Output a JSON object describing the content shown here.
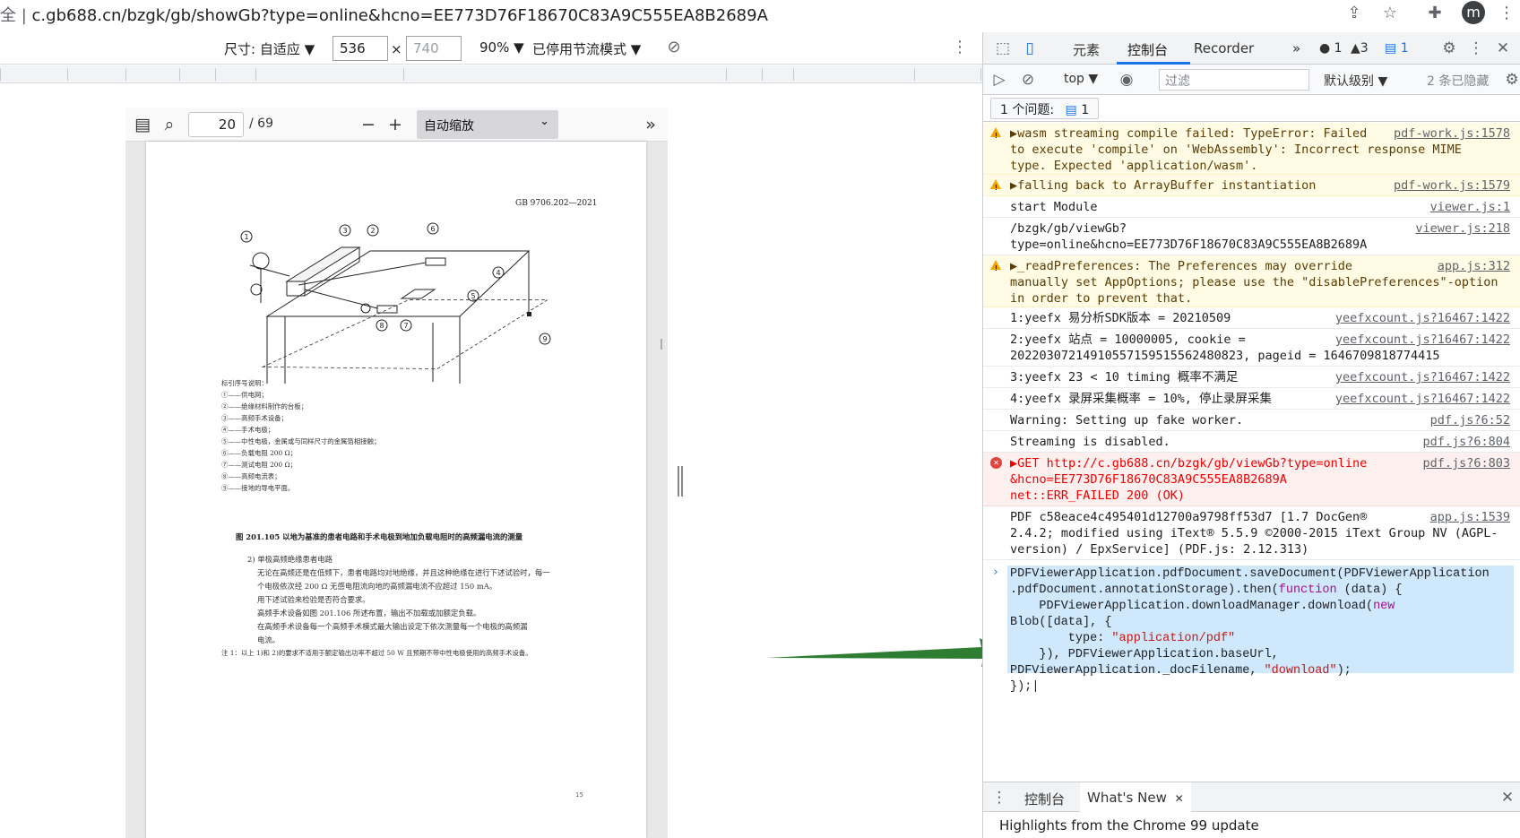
{
  "address_bar": {
    "prefix": "全 |",
    "url": "c.gb688.cn/bzgk/gb/showGb?type=online&hcno=EE773D76F18670C83A9C555EA8B2689A",
    "avatar_letter": "m"
  },
  "device_toolbar": {
    "dimensions_label": "尺寸: 自适应 ▼",
    "width_value": "536",
    "times": "×",
    "height_placeholder": "740",
    "zoom": "90% ▼",
    "throttle": "已停用节流模式 ▼"
  },
  "pdf_viewer": {
    "page_number": "20",
    "page_total": "/ 69",
    "zoom_option": "自动缩放",
    "page": {
      "standard_no": "GB 9706.202—2021",
      "legend_title": "标引序号说明：",
      "legend": [
        "①——供电网；",
        "②——绝缘材料制作的台板；",
        "③——高频手术设备；",
        "④——手术电极；",
        "⑤——中性电极，金属或与同样尺寸的金属箔相接触；",
        "⑥——负载电阻 200 Ω；",
        "⑦——测试电阻 200 Ω；",
        "⑧——高频电流表；",
        "⑨——接地的导电平面。"
      ],
      "figure_caption": "图 201.105    以地为基准的患者电路和手术电极到地加负载电阻时的高频漏电流的测量",
      "section_heading": "2)    单极高频绝缘患者电路",
      "body_lines": [
        "无论在高频还是在低频下，患者电路均对地绝缘，并且这种绝缘在进行下述试验时，每一",
        "个电极依次经 200 Ω 无感电阻流向地的高频漏电流不应超过 150 mA。",
        "用下述试验来检验是否符合要求。",
        "高频手术设备如图 201.106 所述布置，输出不加载或加额定负载。",
        "在高频手术设备每一个高频手术模式最大输出设定下依次测量每一个电极的高频漏",
        "电流。"
      ],
      "note": "注 1：以上 1)和 2)的要求不适用于额定输出功率不超过 50 W 且预期不带中性电极使用的高频手术设备。",
      "page_footer": "15",
      "figure_labels": [
        "1",
        "2",
        "3",
        "4",
        "5",
        "6",
        "7",
        "8",
        "9"
      ]
    }
  },
  "devtools": {
    "tabs": [
      "元素",
      "控制台",
      "Recorder",
      "»"
    ],
    "active_tab": "控制台",
    "counters": {
      "errors": "1",
      "warnings": "3",
      "messages": "1"
    },
    "filter": {
      "context": "top ▼",
      "placeholder": "过滤",
      "level": "默认级别 ▼",
      "hidden": "2 条已隐藏"
    },
    "issues": {
      "label": "1 个问题:",
      "count": "1"
    },
    "log": [
      {
        "type": "warn",
        "text": "▶wasm streaming compile failed: TypeError: Failed\nto execute 'compile' on 'WebAssembly': Incorrect response MIME\ntype. Expected 'application/wasm'.",
        "source": "pdf-work.js:1578"
      },
      {
        "type": "warn",
        "text": "▶falling back to ArrayBuffer instantiation",
        "source": "pdf-work.js:1579"
      },
      {
        "type": "log",
        "text": "start Module",
        "source": "viewer.js:1"
      },
      {
        "type": "log",
        "text": "/bzgk/gb/viewGb?\ntype=online&hcno=EE773D76F18670C83A9C555EA8B2689A",
        "source": "viewer.js:218"
      },
      {
        "type": "warn",
        "text": "▶_readPreferences: The Preferences may override\nmanually set AppOptions; please use the \"disablePreferences\"-option\nin order to prevent that.",
        "source": "app.js:312"
      },
      {
        "type": "log",
        "text": "1:yeefx 易分析SDK版本 = 20210509",
        "source": "yeefxcount.js?16467:1422"
      },
      {
        "type": "log",
        "text": "2:yeefx 站点 = 10000005, cookie =\n20220307214910557159515562480823, pageid = 1646709818774415",
        "source": "yeefxcount.js?16467:1422"
      },
      {
        "type": "log",
        "text": "3:yeefx 23 < 10 timing 概率不满足",
        "source": "yeefxcount.js?16467:1422"
      },
      {
        "type": "log",
        "text": "4:yeefx 录屏采集概率 = 10%, 停止录屏采集",
        "source": "yeefxcount.js?16467:1422"
      },
      {
        "type": "log",
        "text": "Warning: Setting up fake worker.",
        "source": "pdf.js?6:52"
      },
      {
        "type": "log",
        "text": "Streaming is disabled.",
        "source": "pdf.js?6:804"
      },
      {
        "type": "err",
        "text": "▶GET http://c.gb688.cn/bzgk/gb/viewGb?type=online\n&hcno=EE773D76F18670C83A9C555EA8B2689A\nnet::ERR_FAILED 200 (OK)",
        "source": "pdf.js?6:803"
      },
      {
        "type": "log",
        "text": "PDF c58eace4c495401d12700a9798ff53d7 [1.7 DocGen®\n2.4.2; modified using iText® 5.5.9 ©2000-2015 iText Group NV (AGPL-\nversion) / EpxService] (PDF.js: 2.12.313)",
        "source": "app.js:1539"
      }
    ],
    "console_input": {
      "line1": "PDFViewerApplication.pdfDocument.saveDocument(PDFViewerApplication",
      "line2a": ".pdfDocument.annotationStorage).then(",
      "line2kw": "function",
      "line2b": " (data) {",
      "line3a": "    PDFViewerApplication.downloadManager.download(",
      "line3kw": "new",
      "line4": "Blob([data], {",
      "line5a": "        type: ",
      "line5s": "\"application/pdf\"",
      "line6": "    }), PDFViewerApplication.baseUrl,",
      "line7a": "PDFViewerApplication._docFilename, ",
      "line7s": "\"download\"",
      "line7b": ");",
      "line8": "});"
    },
    "drawer": {
      "tabs": [
        "控制台",
        "What's New"
      ],
      "close_glyph": "✕",
      "content": "Highlights from the Chrome 99 update"
    }
  },
  "colors": {
    "arrow": "#2e7d32",
    "accent": "#1a73e8",
    "warn_bg": "#fffbe5",
    "err_bg": "#fff0f0",
    "selection": "#cfe8fc"
  }
}
